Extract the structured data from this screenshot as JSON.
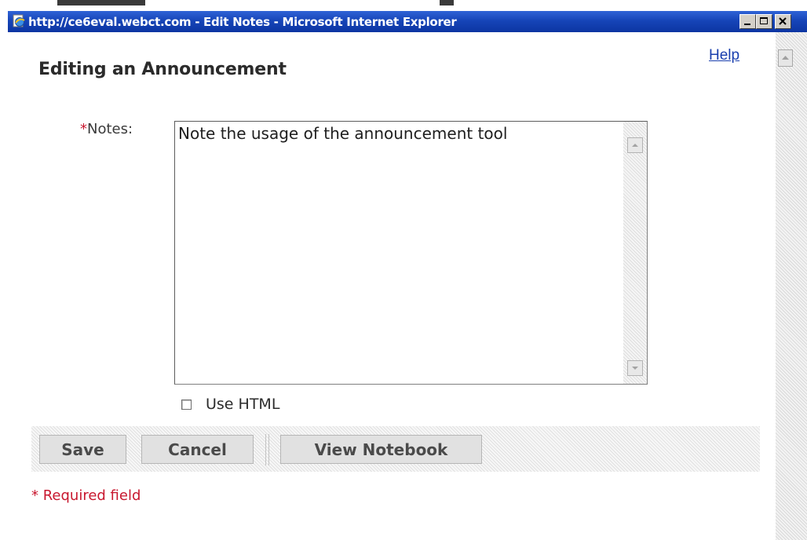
{
  "window": {
    "title": "http://ce6eval.webct.com - Edit Notes - Microsoft Internet Explorer",
    "controls": [
      "minimize",
      "maximize",
      "close"
    ]
  },
  "page": {
    "help_link": "Help",
    "title": "Editing an Announcement"
  },
  "form": {
    "notes_required_marker": "*",
    "notes_label": "Notes:",
    "notes_value": "Note the usage of the announcement tool",
    "use_html_label": "Use HTML",
    "use_html_checked": false
  },
  "buttons": {
    "save": "Save",
    "cancel": "Cancel",
    "view_notebook": "View Notebook"
  },
  "footer": {
    "required_note": "* Required field"
  },
  "colors": {
    "titlebar": "#0c35a2",
    "link": "#1a3fae",
    "required": "#c8182f"
  },
  "icons": {
    "app": "ie-page-icon",
    "scroll_up": "scroll-up-arrow-icon",
    "scroll_down": "scroll-down-arrow-icon"
  }
}
